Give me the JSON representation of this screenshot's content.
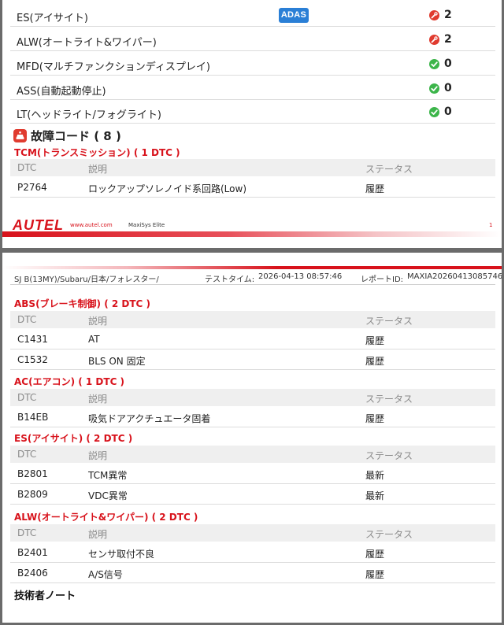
{
  "page1": {
    "system_status": [
      {
        "name": "ES(アイサイト)",
        "badge": "ADAS",
        "status": "fault",
        "count": "2"
      },
      {
        "name": "ALW(オートライト&ワイパー)",
        "status": "fault",
        "count": "2"
      },
      {
        "name": "MFD(マルチファンクションディスプレイ)",
        "status": "ok",
        "count": "0"
      },
      {
        "name": "ASS(自動起動停止)",
        "status": "ok",
        "count": "0"
      },
      {
        "name": "LT(ヘッドライト/フォグライト)",
        "status": "ok",
        "count": "0"
      }
    ],
    "dtc_heading": "故障コード ( 8 )",
    "group": {
      "title": "TCM(トランスミッション) ( 1 DTC )",
      "rows": [
        {
          "code": "P2764",
          "desc": "ロックアップソレノイド系回路(Low)",
          "status": "履歴"
        }
      ]
    },
    "footer": {
      "logo": "AUTEL",
      "url": "www.autel.com",
      "model": "MaxiSys Elite",
      "page_no": "1"
    }
  },
  "table_headers": {
    "code": "DTC",
    "desc": "説明",
    "status": "ステータス"
  },
  "page2": {
    "header": {
      "vehicle": "SJ B(13MY)/Subaru/日本/フォレスター/",
      "test_time_label": "テストタイム:",
      "test_time": "2026-04-13 08:57:46",
      "report_id_label": "レポートID:",
      "report_id": "MAXIA20260413085746"
    },
    "groups": [
      {
        "title": "ABS(ブレーキ制御) ( 2 DTC )",
        "rows": [
          {
            "code": "C1431",
            "desc": "AT",
            "status": "履歴"
          },
          {
            "code": "C1532",
            "desc": "BLS ON 固定",
            "status": "履歴"
          }
        ]
      },
      {
        "title": "AC(エアコン) ( 1 DTC )",
        "rows": [
          {
            "code": "B14EB",
            "desc": "吸気ドアアクチュエータ固着",
            "status": "履歴"
          }
        ]
      },
      {
        "title": "ES(アイサイト) ( 2 DTC )",
        "rows": [
          {
            "code": "B2801",
            "desc": "TCM異常",
            "status": "最新"
          },
          {
            "code": "B2809",
            "desc": "VDC異常",
            "status": "最新"
          }
        ]
      },
      {
        "title": "ALW(オートライト&ワイパー) ( 2 DTC )",
        "rows": [
          {
            "code": "B2401",
            "desc": "センサ取付不良",
            "status": "履歴"
          },
          {
            "code": "B2406",
            "desc": "A/S信号",
            "status": "履歴"
          }
        ]
      }
    ],
    "notes_title": "技術者ノート"
  },
  "colors": {
    "accent": "#d8121b",
    "fault": "#e03b2f",
    "ok": "#3cb54a",
    "badge": "#2a7fd6"
  }
}
